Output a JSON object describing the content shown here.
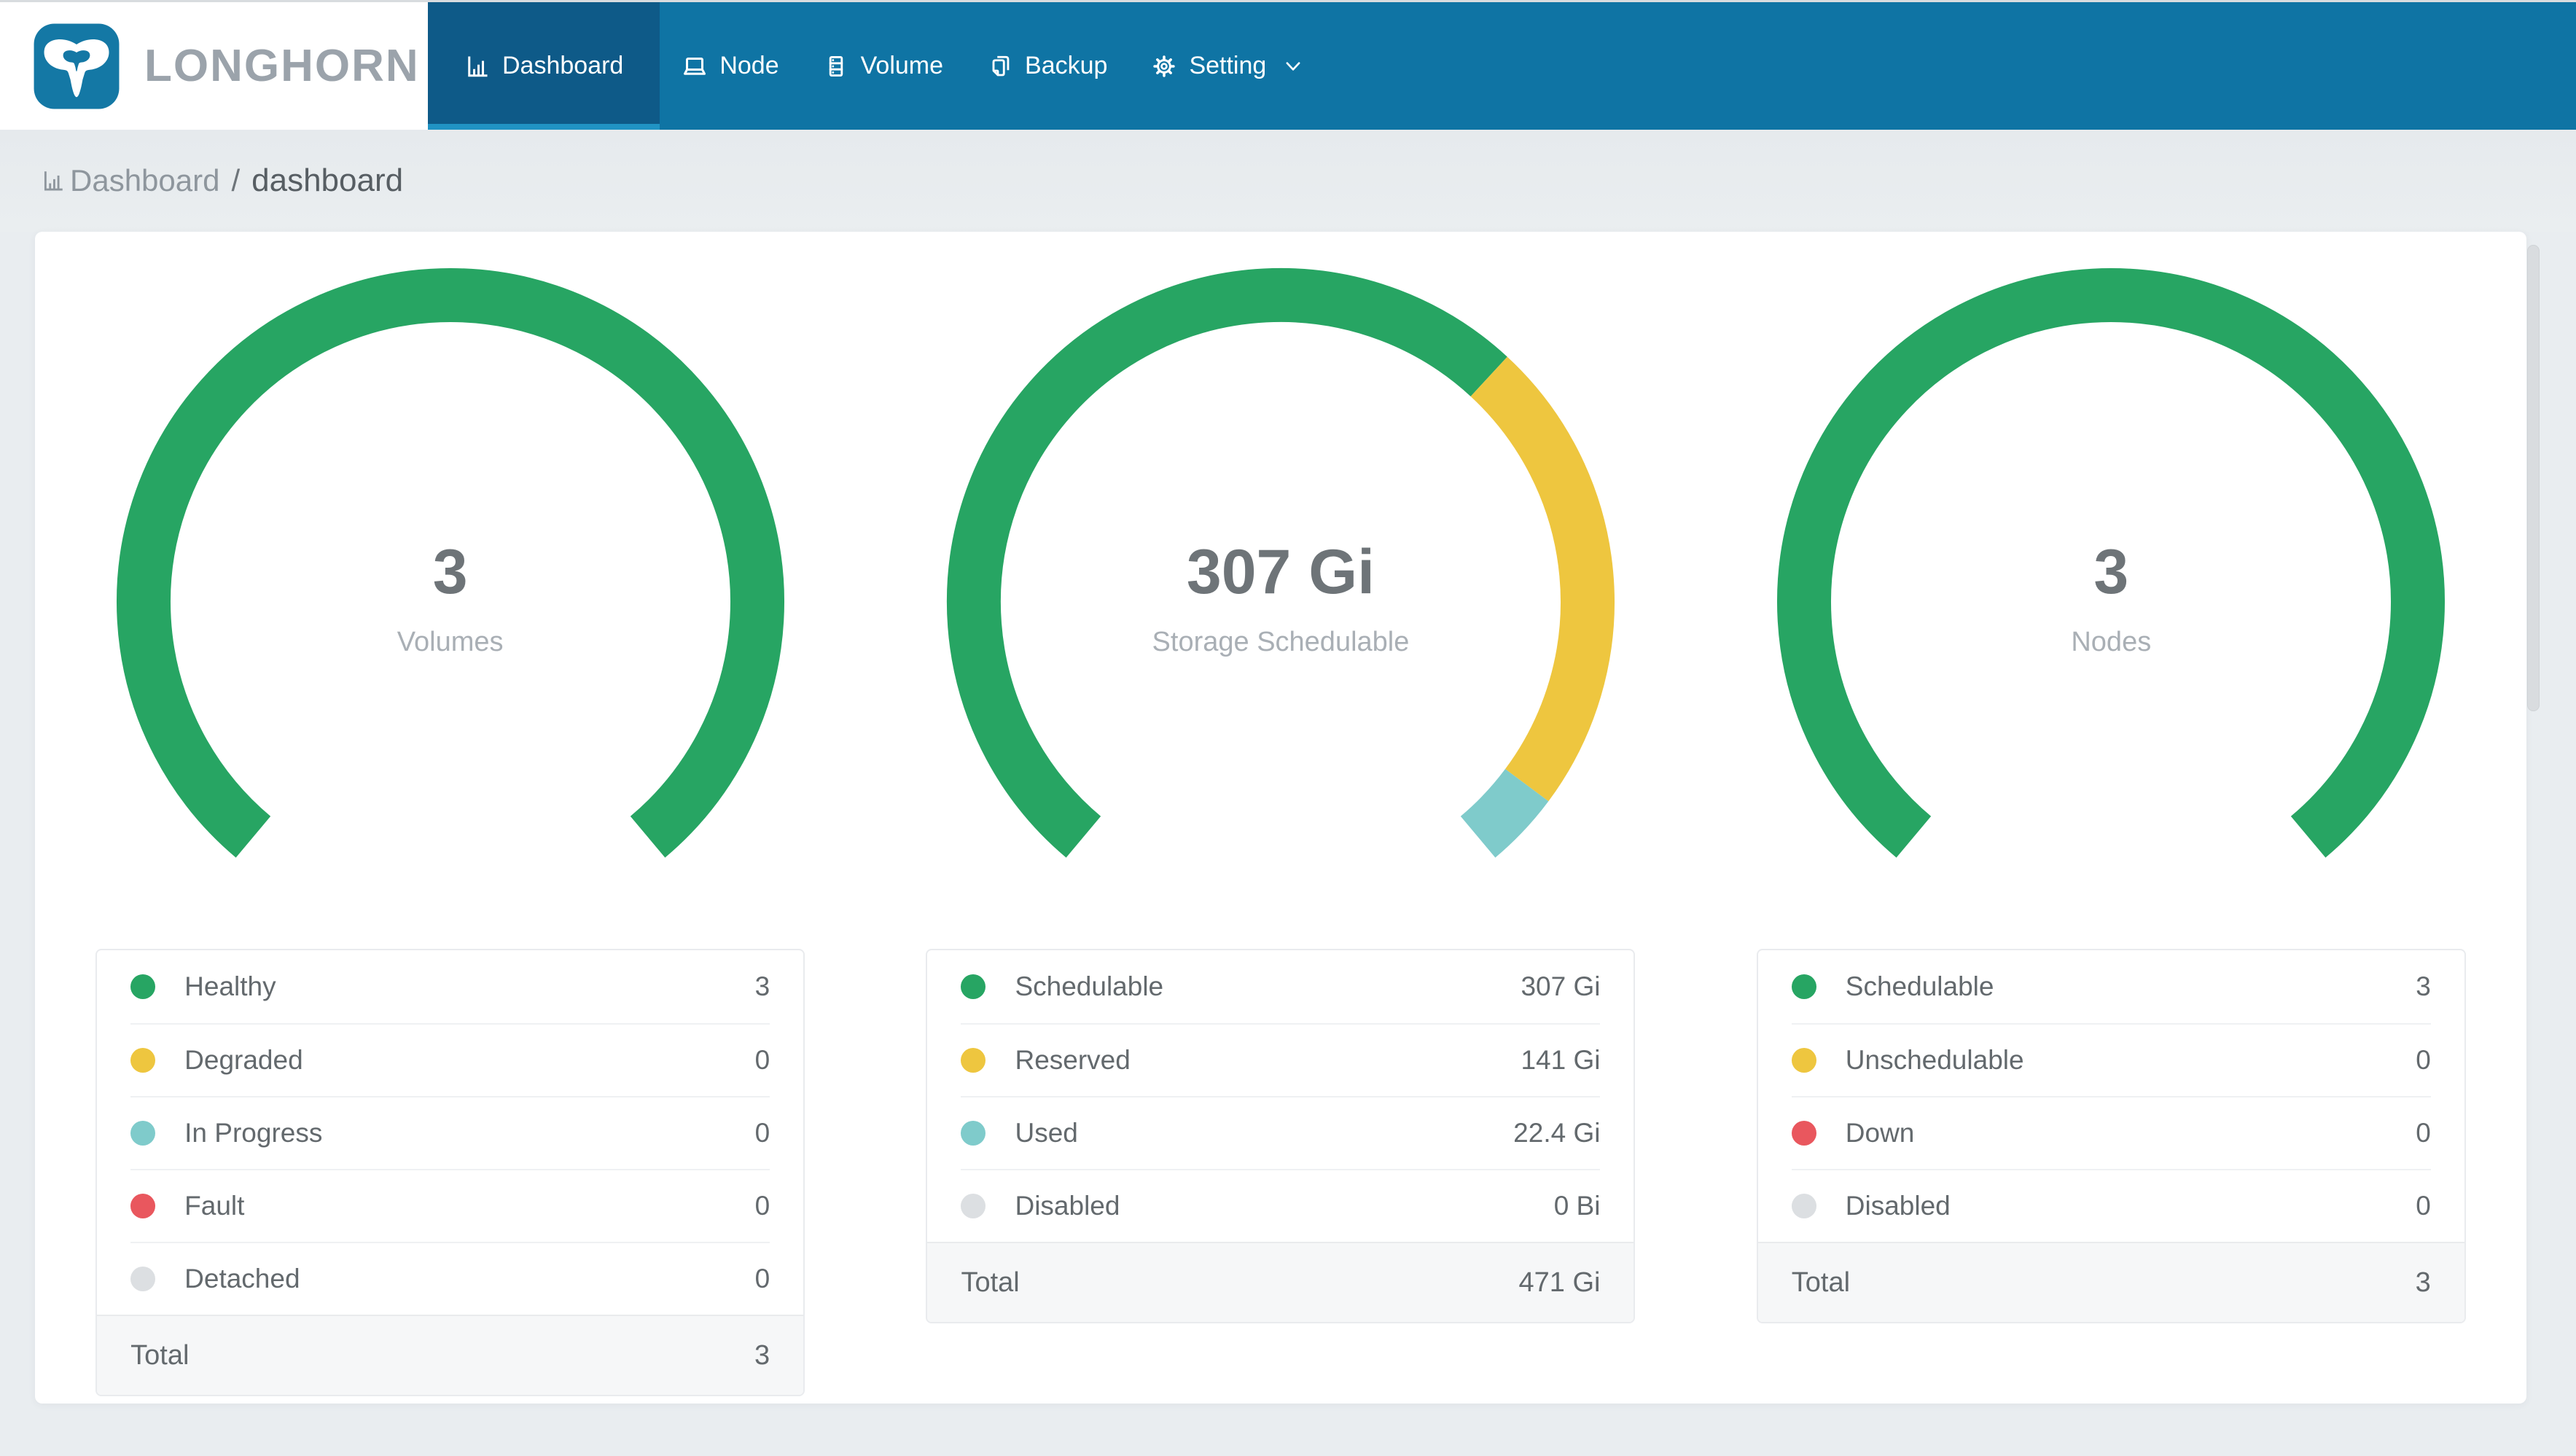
{
  "navbar": {
    "brand": "LONGHORN",
    "items": [
      {
        "label": "Dashboard",
        "icon": "bar-chart-icon",
        "active": true
      },
      {
        "label": "Node",
        "icon": "laptop-icon",
        "active": false
      },
      {
        "label": "Volume",
        "icon": "database-icon",
        "active": false
      },
      {
        "label": "Backup",
        "icon": "copy-icon",
        "active": false
      },
      {
        "label": "Setting",
        "icon": "gear-icon",
        "active": false,
        "dropdown": true
      }
    ]
  },
  "breadcrumb": {
    "icon": "bar-chart-icon",
    "section": "Dashboard",
    "separator": "/",
    "page": "dashboard"
  },
  "colors": {
    "navbar": "#0F74A4",
    "navbar_active_bg": "#0E5A88",
    "navbar_active_underline": "#2093C4",
    "page_bg": "#E9EDF0",
    "card_bg": "#FFFFFF",
    "green": "#27A563",
    "yellow": "#EEC63F",
    "teal": "#7FCBCB",
    "red": "#E9575E",
    "gray": "#DCDFE2"
  },
  "chart_data": [
    {
      "type": "gauge-donut",
      "title": "Volumes",
      "center": {
        "value": "3",
        "caption": "Volumes"
      },
      "arc": {
        "start_deg": 220,
        "sweep_deg": 280,
        "outer_r": 458,
        "thickness": 74
      },
      "segments": [
        {
          "label": "Healthy",
          "value": 3,
          "display": "3",
          "color": "#27A563"
        },
        {
          "label": "Degraded",
          "value": 0,
          "display": "0",
          "color": "#EEC63F"
        },
        {
          "label": "In Progress",
          "value": 0,
          "display": "0",
          "color": "#7FCBCB"
        },
        {
          "label": "Fault",
          "value": 0,
          "display": "0",
          "color": "#E9575E"
        },
        {
          "label": "Detached",
          "value": 0,
          "display": "0",
          "color": "#DCDFE2"
        }
      ],
      "total": {
        "label": "Total",
        "display": "3"
      }
    },
    {
      "type": "gauge-donut",
      "title": "Storage Schedulable",
      "center": {
        "value": "307 Gi",
        "caption": "Storage Schedulable"
      },
      "arc": {
        "start_deg": 220,
        "sweep_deg": 280,
        "outer_r": 458,
        "thickness": 74
      },
      "segments": [
        {
          "label": "Schedulable",
          "value": 307,
          "display": "307 Gi",
          "color": "#27A563"
        },
        {
          "label": "Reserved",
          "value": 141,
          "display": "141 Gi",
          "color": "#EEC63F"
        },
        {
          "label": "Used",
          "value": 22.4,
          "display": "22.4 Gi",
          "color": "#7FCBCB"
        },
        {
          "label": "Disabled",
          "value": 0,
          "display": "0 Bi",
          "color": "#DCDFE2"
        }
      ],
      "total": {
        "label": "Total",
        "display": "471 Gi"
      }
    },
    {
      "type": "gauge-donut",
      "title": "Nodes",
      "center": {
        "value": "3",
        "caption": "Nodes"
      },
      "arc": {
        "start_deg": 220,
        "sweep_deg": 280,
        "outer_r": 458,
        "thickness": 74
      },
      "segments": [
        {
          "label": "Schedulable",
          "value": 3,
          "display": "3",
          "color": "#27A563"
        },
        {
          "label": "Unschedulable",
          "value": 0,
          "display": "0",
          "color": "#EEC63F"
        },
        {
          "label": "Down",
          "value": 0,
          "display": "0",
          "color": "#E9575E"
        },
        {
          "label": "Disabled",
          "value": 0,
          "display": "0",
          "color": "#DCDFE2"
        }
      ],
      "total": {
        "label": "Total",
        "display": "3"
      }
    }
  ]
}
